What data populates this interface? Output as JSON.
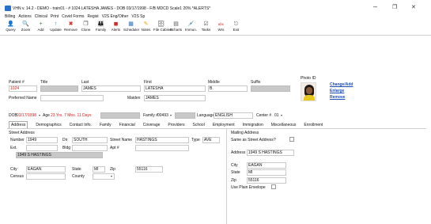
{
  "window": {
    "title": "VHN v. 14.2 - DEMO - train01 - # 1024  LATESHA JAMES - DOB 03/17/1998 - F/B MDCD  Scale1  20% *ALERTS*",
    "minimize": "–",
    "restore": "❐",
    "close": "✕"
  },
  "menu": [
    "Billing",
    "Actions",
    "Clinical",
    "Print",
    "Covid Forms",
    "Regist",
    "V2S Eng/Other",
    "V2S Sp"
  ],
  "toolbar": [
    {
      "label": "Query",
      "icon": "query-icon",
      "glyph": "👤",
      "color": "#555"
    },
    {
      "label": "Zoom",
      "icon": "zoom-icon",
      "glyph": "🔍",
      "color": "#555"
    },
    {
      "label": "Add",
      "icon": "add-icon",
      "glyph": "+",
      "color": "#2a8a2a"
    },
    {
      "label": "Update",
      "icon": "update-icon",
      "glyph": "↑",
      "color": "#2a6fc9"
    },
    {
      "label": "Remove",
      "icon": "remove-icon",
      "glyph": "✖",
      "color": "#c9302c"
    },
    {
      "label": "Clone",
      "icon": "clone-icon",
      "glyph": "❐",
      "color": "#444"
    },
    {
      "label": "Family",
      "icon": "family-icon",
      "glyph": "👪",
      "color": "#444"
    },
    {
      "label": "Alerts",
      "icon": "alerts-icon",
      "glyph": "◼",
      "color": "#c9302c"
    },
    {
      "label": "Scheduler",
      "icon": "scheduler-icon",
      "glyph": "▦",
      "color": "#2a6fc9"
    },
    {
      "label": "Notes",
      "icon": "notes-icon",
      "glyph": "✎",
      "color": "#e0a400"
    },
    {
      "label": "File Cabinet",
      "icon": "file-cabinet-icon",
      "glyph": "🗄",
      "color": "#555"
    },
    {
      "label": "Echarts",
      "icon": "echarts-icon",
      "glyph": "▤",
      "color": "#555"
    },
    {
      "label": "Immun.",
      "icon": "immunization-icon",
      "glyph": "💉",
      "color": "#555"
    },
    {
      "label": "Tasks",
      "icon": "tasks-icon",
      "glyph": "☑",
      "color": "#555"
    },
    {
      "label": "Wrs",
      "icon": "spell-check-icon",
      "glyph": "abc",
      "color": "#c9302c"
    },
    {
      "label": "Exit",
      "icon": "exit-icon",
      "glyph": "⎋",
      "color": "#555"
    }
  ],
  "patient": {
    "labels": {
      "patient_num": "Patient #",
      "title": "Title",
      "last": "Last",
      "first": "First",
      "middle": "Middle",
      "suffix": "Suffix",
      "preferred": "Preferred Name",
      "maiden": "Maiden",
      "dob": "DOB",
      "age": "Age",
      "family": "Family #",
      "language": "Language",
      "center": "Center #"
    },
    "patient_num": "1024",
    "last": "JAMES",
    "first": "LATESHA",
    "middle": "B.",
    "maiden": "JAMES",
    "dob": "03/17/1998",
    "age": "23 Yrs.  7 Mos. 11 Days",
    "family": "00493",
    "language": "ENGLISH",
    "center": "01"
  },
  "photo": {
    "label": "Photo ID",
    "links": [
      "Change/Add",
      "Enlarge",
      "Remove"
    ]
  },
  "tabs": [
    "Address",
    "Demographics",
    "Contact Info.",
    "Family",
    "Financial",
    "Coverage",
    "Providers",
    "School",
    "Employment",
    "Immigration",
    "Miscellaneous",
    "Enrollment"
  ],
  "street": {
    "section": "Street Address",
    "labels": {
      "number": "Number",
      "dir": "Dir",
      "street_name": "Street Name",
      "type": "Type",
      "ext": "Ext.",
      "bldg": "Bldg",
      "apt": "Apt #",
      "city": "City",
      "state": "State",
      "zip": "Zip",
      "census": "Census",
      "county": "County"
    },
    "number": "1949",
    "dir": "SOUTH",
    "street_name": "HASTINGS",
    "type": "AVE",
    "full": "1949 S HASTINGS",
    "city": "EAGAN",
    "state": "MI",
    "zip": "55116"
  },
  "mailing": {
    "section": "Mailing Address",
    "same_label": "Same as Street Address?",
    "labels": {
      "address": "Address",
      "city": "City",
      "state": "State",
      "zip": "Zip",
      "plain": "Use Plain Envelope"
    },
    "address": "1949 S HASTINGS",
    "city": "EAGAN",
    "state": "MI",
    "zip": "55116"
  }
}
